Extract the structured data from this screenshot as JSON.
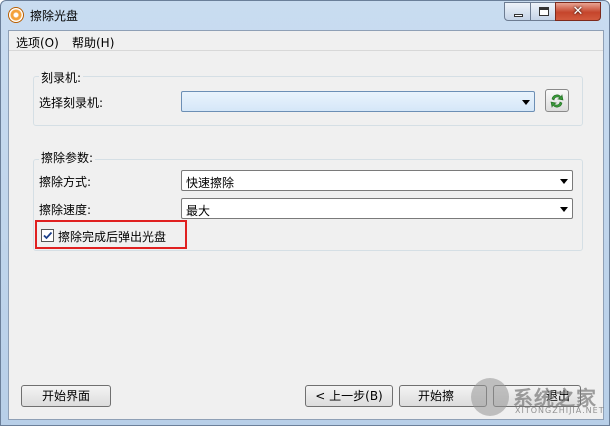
{
  "window": {
    "title": "擦除光盘",
    "close_glyph": "✕"
  },
  "menu": {
    "items": [
      "选项(O)",
      "帮助(H)"
    ]
  },
  "burner_group": {
    "title": "刻录机:",
    "select_label": "选择刻录机:",
    "select_value": "",
    "refresh_icon": "refresh-icon"
  },
  "erase_group": {
    "title": "擦除参数:",
    "method_label": "擦除方式:",
    "method_value": "快速擦除",
    "speed_label": "擦除速度:",
    "speed_value": "最大",
    "eject_checkbox_label": "擦除完成后弹出光盘",
    "eject_checked": true
  },
  "footer": {
    "start_page_button": "开始界面",
    "prev_button": "< 上一步(B)",
    "start_button": "开始擦",
    "exit_button": "退出"
  },
  "watermark": {
    "text": "系统之家",
    "sub": "XITONGZHIJIA.NET"
  },
  "colors": {
    "highlight": "#e02020",
    "accent": "#2e8b2e"
  }
}
